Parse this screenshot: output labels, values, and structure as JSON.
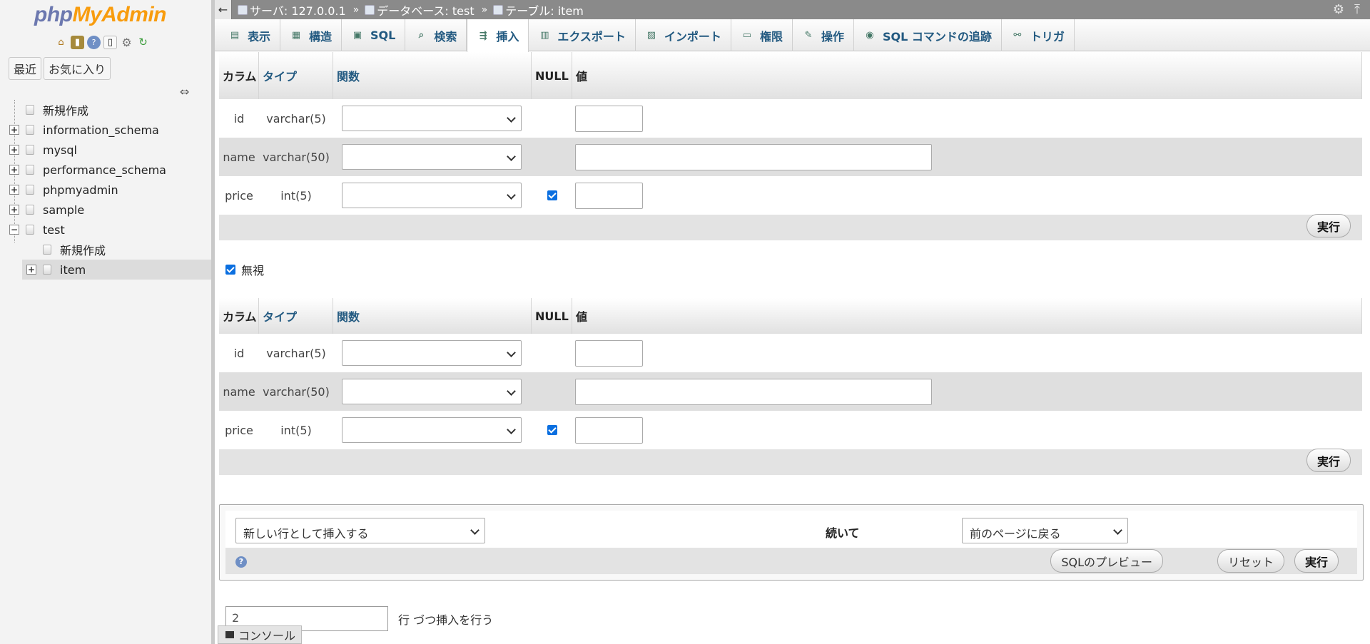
{
  "nav": {
    "logo_a": "php",
    "logo_b": "MyAdmin",
    "tabs": [
      "最近",
      "お気に入り"
    ],
    "tree": [
      {
        "label": "新規作成",
        "level": 0,
        "expander": ""
      },
      {
        "label": "information_schema",
        "level": 0,
        "expander": "+"
      },
      {
        "label": "mysql",
        "level": 0,
        "expander": "+"
      },
      {
        "label": "performance_schema",
        "level": 0,
        "expander": "+"
      },
      {
        "label": "phpmyadmin",
        "level": 0,
        "expander": "+"
      },
      {
        "label": "sample",
        "level": 0,
        "expander": "+"
      },
      {
        "label": "test",
        "level": 0,
        "expander": "−"
      },
      {
        "label": "新規作成",
        "level": 1,
        "expander": ""
      },
      {
        "label": "item",
        "level": 1,
        "expander": "+",
        "selected": true
      }
    ]
  },
  "breadcrumb": {
    "server": "サーバ: 127.0.0.1",
    "database": "データベース: test",
    "table": "テーブル: item",
    "sep": "»"
  },
  "menu": [
    {
      "label": "表示",
      "icon": "browse-icon"
    },
    {
      "label": "構造",
      "icon": "structure-icon"
    },
    {
      "label": "SQL",
      "icon": "sql-icon"
    },
    {
      "label": "検索",
      "icon": "search-icon"
    },
    {
      "label": "挿入",
      "icon": "insert-icon",
      "active": true
    },
    {
      "label": "エクスポート",
      "icon": "export-icon"
    },
    {
      "label": "インポート",
      "icon": "import-icon"
    },
    {
      "label": "権限",
      "icon": "privileges-icon"
    },
    {
      "label": "操作",
      "icon": "operations-icon"
    },
    {
      "label": "SQL コマンドの追跡",
      "icon": "tracking-icon"
    },
    {
      "label": "トリガ",
      "icon": "triggers-icon"
    }
  ],
  "table_headers": {
    "column": "カラム",
    "type": "タイプ",
    "function": "関数",
    "null": "NULL",
    "value": "値"
  },
  "rows": [
    {
      "name": "id",
      "type": "varchar(5)",
      "null_checked": false,
      "input": "short"
    },
    {
      "name": "name",
      "type": "varchar(50)",
      "null_checked": false,
      "input": "long"
    },
    {
      "name": "price",
      "type": "int(5)",
      "null_checked": true,
      "input": "short"
    }
  ],
  "go_label": "実行",
  "ignore_label": "無視",
  "options": {
    "insert_mode": "新しい行として挿入する",
    "then_label": "続いて",
    "after_action": "前のページに戻る",
    "preview_label": "SQLのプレビュー",
    "reset_label": "リセット",
    "go_label": "実行"
  },
  "rows_count": "2",
  "rows_count_label": "行 づつ挿入を行う",
  "console_label": "コンソール"
}
